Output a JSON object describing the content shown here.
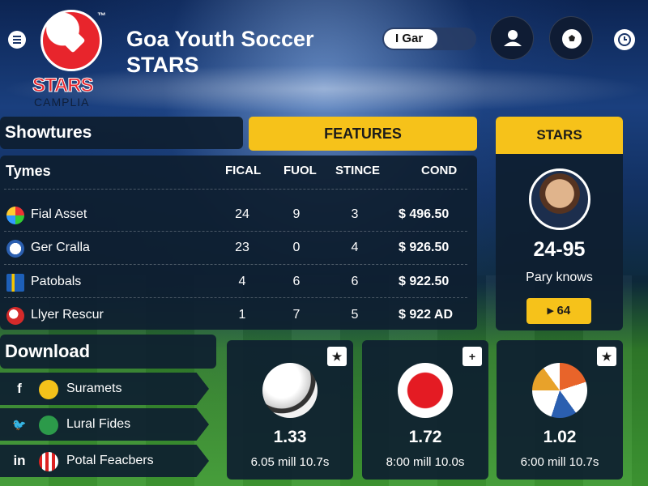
{
  "header": {
    "title": "Goa Youth Soccer STARS",
    "search_value": "I Gar",
    "logo": {
      "tm": "™",
      "wordmark": "STARS",
      "sub": "CAMPLIA"
    }
  },
  "showtures": {
    "title": "Showtures",
    "features_tab": "FEATURES"
  },
  "table": {
    "headers": [
      "Tymes",
      "FICAL",
      "FUOL",
      "STINCE",
      "COND"
    ],
    "rows": [
      {
        "name": "Fial Asset",
        "fical": "24",
        "fuol": "9",
        "stince": "3",
        "cond": "$ 496.50"
      },
      {
        "name": "Ger Cralla",
        "fical": "23",
        "fuol": "0",
        "stince": "4",
        "cond": "$ 926.50"
      },
      {
        "name": "Patobals",
        "fical": "4",
        "fuol": "6",
        "stince": "6",
        "cond": "$ 922.50"
      },
      {
        "name": "Llyer Rescur",
        "fical": "1",
        "fuol": "7",
        "stince": "5",
        "cond": "$ 922 AD"
      }
    ]
  },
  "stars": {
    "title": "STARS",
    "score": "24-95",
    "subtitle": "Pary knows",
    "button": "▸ 64"
  },
  "download": {
    "title": "Download",
    "items": [
      {
        "social": "f",
        "label": "Suramets"
      },
      {
        "social": "🐦",
        "label": "Lural Fides"
      },
      {
        "social": "in",
        "label": "Potal Feacbers"
      }
    ]
  },
  "cards": [
    {
      "button": "★",
      "odds": "1.33",
      "meta": "6.05 mill 10.7s"
    },
    {
      "button": "+",
      "odds": "1.72",
      "meta": "8:00 mill 10.0s"
    },
    {
      "button": "★",
      "odds": "1.02",
      "meta": "6:00 mill 10.7s"
    }
  ],
  "colors": {
    "accent": "#f6c21a",
    "panel": "#0e1e30",
    "brand_red": "#e8252c"
  }
}
